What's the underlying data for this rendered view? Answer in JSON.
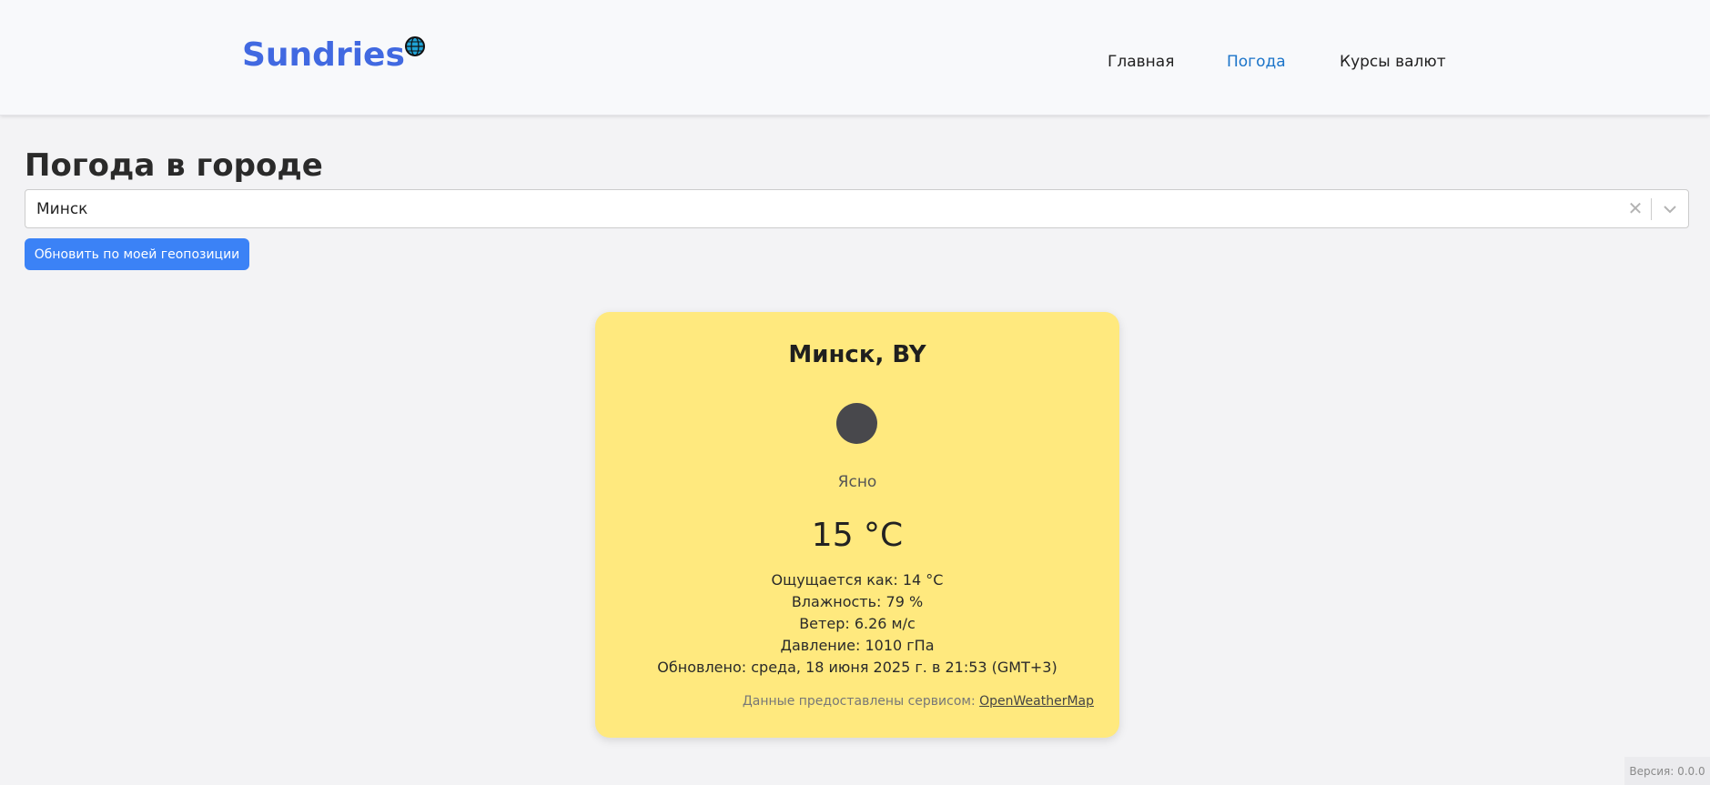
{
  "header": {
    "logo_text": "Sundries",
    "logo_icon": "globe-icon",
    "nav": [
      {
        "label": "Главная",
        "active": false
      },
      {
        "label": "Погода",
        "active": true
      },
      {
        "label": "Курсы валют",
        "active": false
      }
    ]
  },
  "page": {
    "title": "Погода в городе",
    "city_select": {
      "value": "Минск",
      "clear_icon": "close-icon",
      "arrow_icon": "chevron-down-icon"
    },
    "geo_button": "Обновить по моей геопозиции"
  },
  "weather": {
    "city": "Минск, BY",
    "icon": "weather-icon",
    "description": "Ясно",
    "temperature": "15 °C",
    "feels_like": "Ощущается как: 14 °C",
    "humidity": "Влажность: 79 %",
    "wind": "Ветер: 6.26 м/с",
    "pressure": "Давление: 1010 гПа",
    "updated": "Обновлено: среда, 18 июня 2025 г. в 21:53 (GMT+3)",
    "attribution_prefix": "Данные предоставлены сервисом:",
    "attribution_link": "OpenWeatherMap",
    "card_color": "#ffe97e"
  },
  "footer": {
    "version": "Версия: 0.0.0"
  },
  "colors": {
    "brand": "#4169e1",
    "nav_active": "#1b74c9",
    "button": "#3b82f6"
  }
}
